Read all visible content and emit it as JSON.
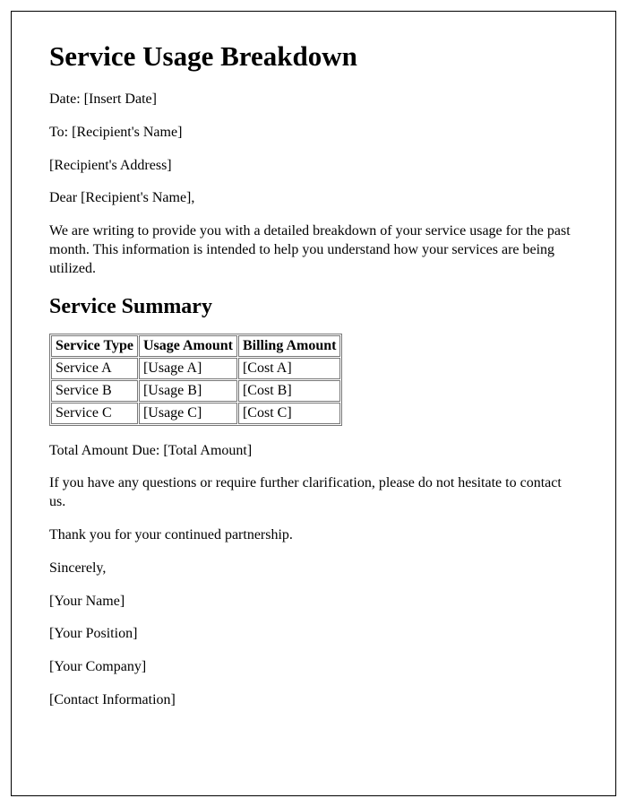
{
  "title": "Service Usage Breakdown",
  "date_label": "Date: ",
  "date_value": "[Insert Date]",
  "to_label": "To: ",
  "to_value": "[Recipient's Name]",
  "recipient_address": "[Recipient's Address]",
  "salutation": "Dear [Recipient's Name],",
  "intro_paragraph": "We are writing to provide you with a detailed breakdown of your service usage for the past month. This information is intended to help you understand how your services are being utilized.",
  "summary_heading": "Service Summary",
  "table": {
    "headers": [
      "Service Type",
      "Usage Amount",
      "Billing Amount"
    ],
    "rows": [
      [
        "Service A",
        "[Usage A]",
        "[Cost A]"
      ],
      [
        "Service B",
        "[Usage B]",
        "[Cost B]"
      ],
      [
        "Service C",
        "[Usage C]",
        "[Cost C]"
      ]
    ]
  },
  "total_label": "Total Amount Due: ",
  "total_value": "[Total Amount]",
  "questions_paragraph": "If you have any questions or require further clarification, please do not hesitate to contact us.",
  "thanks_paragraph": "Thank you for your continued partnership.",
  "closing": "Sincerely,",
  "sender_name": "[Your Name]",
  "sender_position": "[Your Position]",
  "sender_company": "[Your Company]",
  "contact_info": "[Contact Information]"
}
